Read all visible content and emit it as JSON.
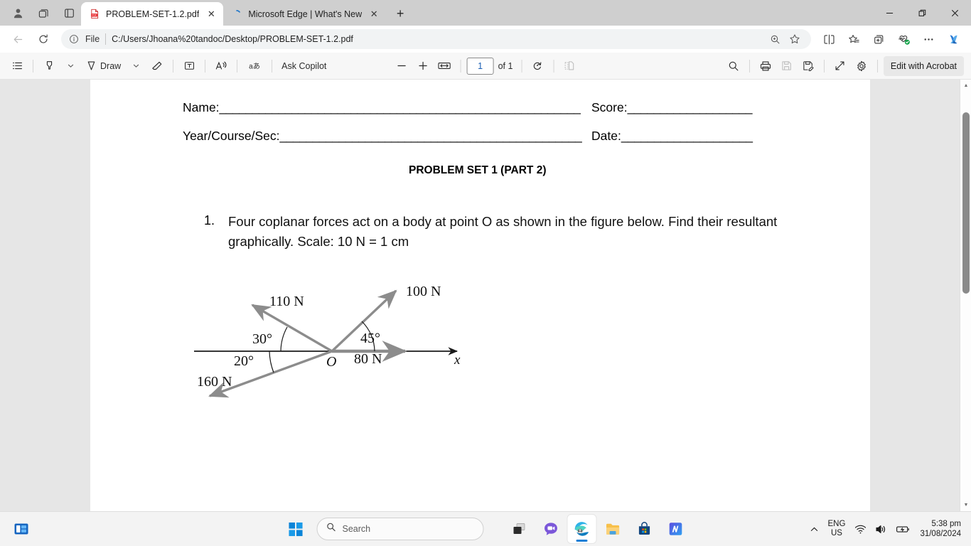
{
  "window": {
    "minimize_label": "Minimize",
    "restore_label": "Restore",
    "close_label": "Close"
  },
  "tabs": {
    "profile_icon": "person-avatar-icon",
    "workspaces_icon": "workspaces-icon",
    "tabactions_icon": "tab-actions-icon",
    "items": [
      {
        "title": "PROBLEM-SET-1.2.pdf",
        "favicon": "pdf-file-icon",
        "active": true
      },
      {
        "title": "Microsoft Edge | What's New",
        "favicon": "loading-spinner-icon",
        "active": false
      }
    ],
    "close_glyph": "✕",
    "newtab_glyph": "+"
  },
  "navbar": {
    "back_icon": "back-arrow-icon",
    "refresh_icon": "refresh-icon",
    "info_icon": "info-circle-icon",
    "scheme_label": "File",
    "url": "C:/Users/Jhoana%20tandoc/Desktop/PROBLEM-SET-1.2.pdf",
    "right_icons": [
      "zoom-search-icon",
      "favorite-star-icon",
      "split-screen-icon",
      "favorites-list-icon",
      "collections-add-icon",
      "browser-essentials-icon",
      "more-settings-ellipsis-icon",
      "copilot-icon"
    ]
  },
  "pdf_toolbar": {
    "left_items": [
      {
        "name": "table-of-contents",
        "icon": "list-icon"
      },
      {
        "name": "highlight",
        "icon": "highlighter-icon",
        "has_chevron": true
      },
      {
        "name": "draw",
        "icon": "draw-pen-icon",
        "label": "Draw",
        "has_chevron": true
      },
      {
        "name": "erase",
        "icon": "eraser-icon"
      },
      {
        "name": "add-text",
        "icon": "text-box-icon"
      },
      {
        "name": "read-aloud",
        "icon": "read-aloud-icon"
      },
      {
        "name": "translate",
        "icon": "translate-icon"
      },
      {
        "name": "ask-copilot",
        "icon": "",
        "label": "Ask Copilot"
      }
    ],
    "zoom_out_glyph": "−",
    "zoom_in_glyph": "+",
    "fit_icon": "fit-to-width-icon",
    "page_number": "1",
    "page_total": "of 1",
    "rotate_icon": "rotate-icon",
    "pageview_icon": "page-view-icon",
    "right_items": [
      {
        "name": "search",
        "icon": "search-icon"
      },
      {
        "name": "print",
        "icon": "printer-icon"
      },
      {
        "name": "save",
        "icon": "save-disk-icon",
        "disabled": true
      },
      {
        "name": "save-as",
        "icon": "save-as-icon"
      },
      {
        "name": "fullscreen",
        "icon": "fullscreen-arrows-icon"
      },
      {
        "name": "settings",
        "icon": "gear-icon"
      }
    ],
    "acrobat_label": "Edit with Acrobat"
  },
  "document": {
    "name_label": "Name:",
    "name_blank": "_______________________________________________________",
    "score_label": "Score:",
    "score_blank": "___________________",
    "year_label": "Year/Course/Sec:",
    "year_blank": "______________________________________________",
    "date_label": "Date:",
    "date_blank": "____________________",
    "title": "PROBLEM SET 1 (PART 2)",
    "question_number": "1.",
    "question_text": "Four coplanar forces act on a body at point O as shown in the figure below. Find their resultant graphically. Scale: 10 N = 1 cm"
  },
  "chart_data": {
    "type": "diagram",
    "subtype": "free-body-force-diagram",
    "title": "Four coplanar forces acting at point O",
    "origin_label": "O",
    "axis_label": "x",
    "axis_description": "Horizontal x-axis through O, arrow pointing right",
    "forces": [
      {
        "label": "110 N",
        "magnitude": 110,
        "unit": "N",
        "angle_deg": 150,
        "angle_from_axis_deg": 30,
        "direction": "up-left",
        "color": "#8c8c8c"
      },
      {
        "label": "100 N",
        "magnitude": 100,
        "unit": "N",
        "angle_deg": 45,
        "angle_from_axis_deg": 45,
        "direction": "up-right",
        "color": "#8c8c8c"
      },
      {
        "label": "80 N",
        "magnitude": 80,
        "unit": "N",
        "angle_deg": 0,
        "angle_from_axis_deg": 0,
        "direction": "right",
        "color": "#8c8c8c"
      },
      {
        "label": "160 N",
        "magnitude": 160,
        "unit": "N",
        "angle_deg": 200,
        "angle_from_axis_deg": 20,
        "direction": "down-left",
        "color": "#8c8c8c"
      }
    ],
    "angle_labels": [
      {
        "text": "30°",
        "value": 30,
        "between": "110 N and negative x-axis"
      },
      {
        "text": "45°",
        "value": 45,
        "between": "100 N and positive x-axis"
      },
      {
        "text": "20°",
        "value": 20,
        "between": "160 N and negative x-axis"
      }
    ]
  },
  "scrollbar": {
    "up_glyph": "▲",
    "down_glyph": "▼"
  },
  "taskbar": {
    "widgets_icon": "widgets-icon",
    "start_icon": "windows-start-icon",
    "search_icon": "search-icon",
    "search_placeholder": "Search",
    "apps": [
      {
        "name": "task-view",
        "icon": "task-view-icon"
      },
      {
        "name": "chat",
        "icon": "chat-teams-icon"
      },
      {
        "name": "microsoft-edge",
        "icon": "edge-icon",
        "active": true
      },
      {
        "name": "file-explorer",
        "icon": "file-explorer-icon"
      },
      {
        "name": "microsoft-store",
        "icon": "microsoft-store-icon"
      },
      {
        "name": "app-m",
        "icon": "blue-m-app-icon"
      }
    ],
    "tray": {
      "overflow_glyph": "∧",
      "language_line1": "ENG",
      "language_line2": "US",
      "wifi_icon": "wifi-icon",
      "volume_icon": "volume-icon",
      "battery_icon": "battery-charging-icon",
      "time": "5:38 pm",
      "date": "31/08/2024"
    }
  }
}
